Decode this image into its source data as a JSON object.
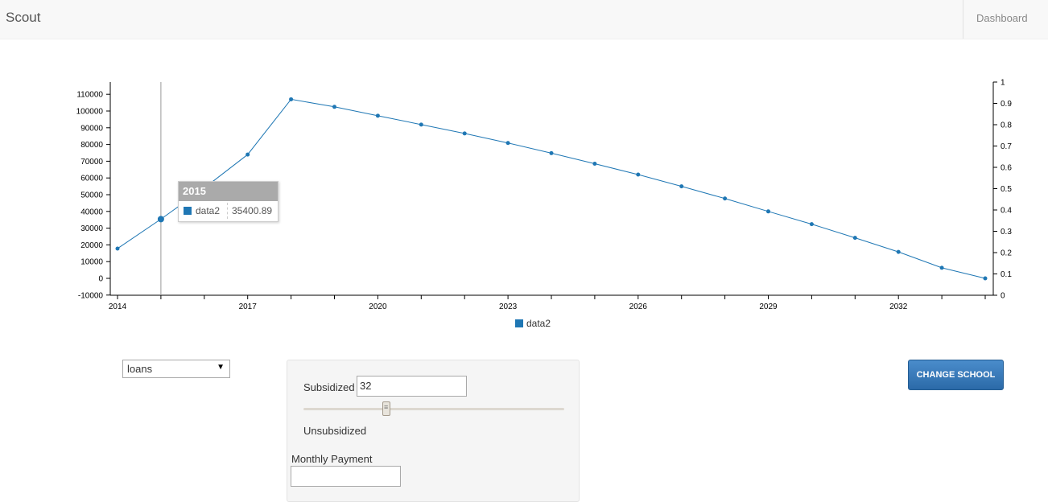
{
  "app": {
    "brand": "Scout",
    "nav_link": "Dashboard"
  },
  "chart_data": {
    "type": "line",
    "x": [
      2014,
      2015,
      2016,
      2017,
      2018,
      2019,
      2020,
      2021,
      2022,
      2023,
      2024,
      2025,
      2026,
      2027,
      2028,
      2029,
      2030,
      2031,
      2032,
      2033,
      2034
    ],
    "series": [
      {
        "name": "data2",
        "values": [
          17800,
          35400.89,
          54000,
          74000,
          107000,
          102500,
          97200,
          91900,
          86600,
          80900,
          74800,
          68500,
          62000,
          55000,
          47700,
          40000,
          32400,
          24200,
          15800,
          6300,
          0
        ]
      }
    ],
    "y_ticks": [
      "-10000",
      "0",
      "10000",
      "20000",
      "30000",
      "40000",
      "50000",
      "60000",
      "70000",
      "80000",
      "90000",
      "100000",
      "110000"
    ],
    "y2_ticks": [
      "0",
      "0.1",
      "0.2",
      "0.3",
      "0.4",
      "0.5",
      "0.6",
      "0.7",
      "0.8",
      "0.9",
      "1"
    ],
    "x_tick_labels": [
      "2014",
      "2017",
      "2020",
      "2023",
      "2026",
      "2029",
      "2032"
    ],
    "ylim": [
      -10000,
      110000
    ],
    "y2lim": [
      0,
      1
    ],
    "legend": "data2",
    "color": "#1f77b4",
    "tooltip": {
      "title": "2015",
      "series": "data2",
      "value": "35400.89"
    },
    "focus_x": 2015
  },
  "controls": {
    "select_value": "loans",
    "subsidized_label": "Subsidized",
    "subsidized_value": "32",
    "unsubsidized_label": "Unsubsidized",
    "monthly_label": "Monthly Payment",
    "monthly_value": "",
    "slider_value": 0.32,
    "change_school": "CHANGE SCHOOL"
  }
}
